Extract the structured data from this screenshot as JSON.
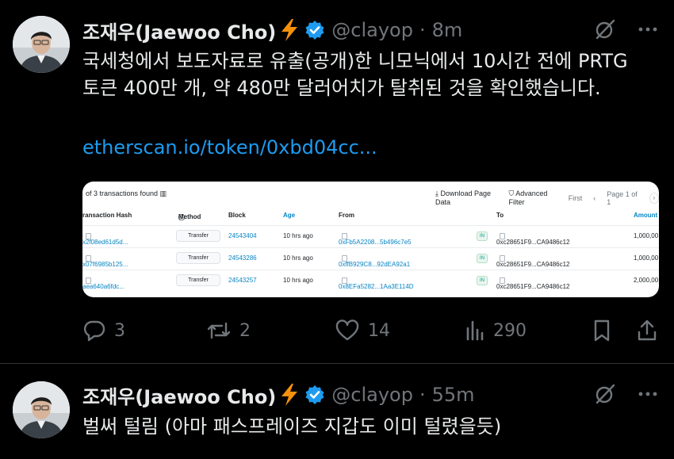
{
  "tweets": [
    {
      "author": "조재우(Jaewoo Cho)",
      "handle": "@clayop",
      "separator": "·",
      "time": "8m",
      "lines": [
        "국세청에서 보도자료로 유출(공개)한 니모닉에서 10시간 전에 PRTG",
        "토큰 400만 개, 약 480만 달러어치가 탈취된 것을 확인했습니다."
      ],
      "link": "etherscan.io/token/0xbd04cc...",
      "actions": {
        "replies": "3",
        "reposts": "2",
        "likes": "14",
        "views": "290"
      }
    },
    {
      "author": "조재우(Jaewoo Cho)",
      "handle": "@clayop",
      "separator": "·",
      "time": "55m",
      "lines": [
        "벌써 털림 (아마 패스프레이즈 지갑도 이미 털렸을듯)"
      ]
    }
  ],
  "etherscan": {
    "count_text": "of 3 transactions found",
    "download": "Download Page Data",
    "advanced": "Advanced Filter",
    "first": "First",
    "page": "Page 1 of 1",
    "columns": {
      "hash": "ransaction Hash",
      "method": "Method",
      "block": "Block",
      "age": "Age",
      "from": "From",
      "to": "To",
      "amount": "Amount"
    },
    "in_badge": "IN",
    "rows": [
      {
        "hash": "x2f08ed61d5d...",
        "method": "Transfer",
        "block": "24543404",
        "age": "10 hrs ago",
        "from": "0xFb5A2208...5b496c7e5",
        "to": "0xc28651F9...CA9486c12",
        "amount": "1,000,00"
      },
      {
        "hash": "x07f6985b125...",
        "method": "Transfer",
        "block": "24543286",
        "age": "10 hrs ago",
        "from": "0xffB929C8...92dEA92a1",
        "to": "0xc28651F9...CA9486c12",
        "amount": "1,000,00"
      },
      {
        "hash": "aea640a6fdc...",
        "method": "Transfer",
        "block": "24543257",
        "age": "10 hrs ago",
        "from": "0x8EFa5282...1Aa3E114D",
        "to": "0xc28651F9...CA9486c12",
        "amount": "2,000,00"
      }
    ]
  },
  "colors": {
    "background": "#000000",
    "text": "#e7e9ea",
    "muted": "#71767b",
    "link": "#1d9bf0",
    "verified": "#1d9bf0",
    "bolt": "#f4900c"
  },
  "icons": [
    "grok-icon",
    "more-icon",
    "verified-icon",
    "lightning-icon",
    "reply-icon",
    "repost-icon",
    "like-icon",
    "views-icon",
    "bookmark-icon",
    "share-icon"
  ]
}
